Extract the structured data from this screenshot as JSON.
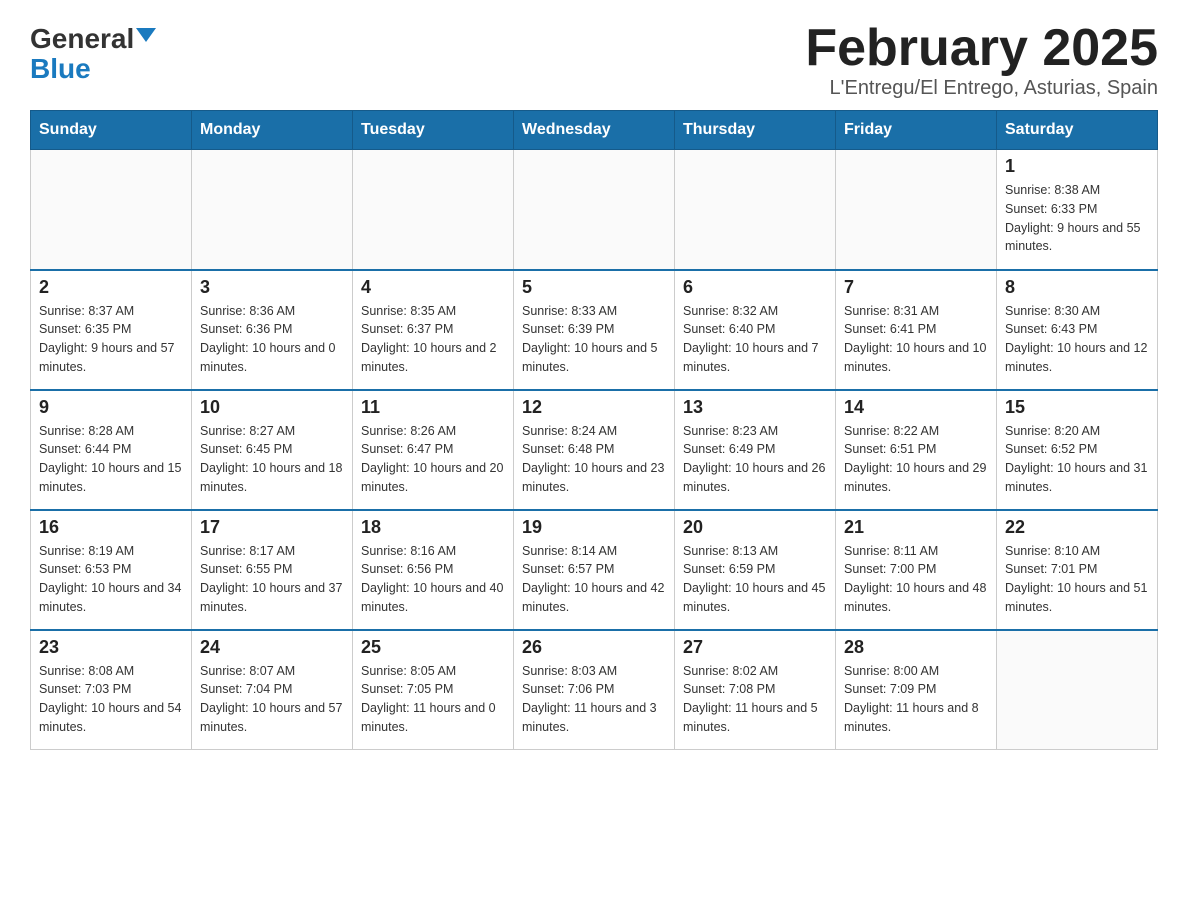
{
  "header": {
    "logo_general": "General",
    "logo_blue": "Blue",
    "title": "February 2025",
    "subtitle": "L'Entregu/El Entrego, Asturias, Spain"
  },
  "days_of_week": [
    "Sunday",
    "Monday",
    "Tuesday",
    "Wednesday",
    "Thursday",
    "Friday",
    "Saturday"
  ],
  "weeks": [
    [
      {
        "day": "",
        "info": ""
      },
      {
        "day": "",
        "info": ""
      },
      {
        "day": "",
        "info": ""
      },
      {
        "day": "",
        "info": ""
      },
      {
        "day": "",
        "info": ""
      },
      {
        "day": "",
        "info": ""
      },
      {
        "day": "1",
        "info": "Sunrise: 8:38 AM\nSunset: 6:33 PM\nDaylight: 9 hours and 55 minutes."
      }
    ],
    [
      {
        "day": "2",
        "info": "Sunrise: 8:37 AM\nSunset: 6:35 PM\nDaylight: 9 hours and 57 minutes."
      },
      {
        "day": "3",
        "info": "Sunrise: 8:36 AM\nSunset: 6:36 PM\nDaylight: 10 hours and 0 minutes."
      },
      {
        "day": "4",
        "info": "Sunrise: 8:35 AM\nSunset: 6:37 PM\nDaylight: 10 hours and 2 minutes."
      },
      {
        "day": "5",
        "info": "Sunrise: 8:33 AM\nSunset: 6:39 PM\nDaylight: 10 hours and 5 minutes."
      },
      {
        "day": "6",
        "info": "Sunrise: 8:32 AM\nSunset: 6:40 PM\nDaylight: 10 hours and 7 minutes."
      },
      {
        "day": "7",
        "info": "Sunrise: 8:31 AM\nSunset: 6:41 PM\nDaylight: 10 hours and 10 minutes."
      },
      {
        "day": "8",
        "info": "Sunrise: 8:30 AM\nSunset: 6:43 PM\nDaylight: 10 hours and 12 minutes."
      }
    ],
    [
      {
        "day": "9",
        "info": "Sunrise: 8:28 AM\nSunset: 6:44 PM\nDaylight: 10 hours and 15 minutes."
      },
      {
        "day": "10",
        "info": "Sunrise: 8:27 AM\nSunset: 6:45 PM\nDaylight: 10 hours and 18 minutes."
      },
      {
        "day": "11",
        "info": "Sunrise: 8:26 AM\nSunset: 6:47 PM\nDaylight: 10 hours and 20 minutes."
      },
      {
        "day": "12",
        "info": "Sunrise: 8:24 AM\nSunset: 6:48 PM\nDaylight: 10 hours and 23 minutes."
      },
      {
        "day": "13",
        "info": "Sunrise: 8:23 AM\nSunset: 6:49 PM\nDaylight: 10 hours and 26 minutes."
      },
      {
        "day": "14",
        "info": "Sunrise: 8:22 AM\nSunset: 6:51 PM\nDaylight: 10 hours and 29 minutes."
      },
      {
        "day": "15",
        "info": "Sunrise: 8:20 AM\nSunset: 6:52 PM\nDaylight: 10 hours and 31 minutes."
      }
    ],
    [
      {
        "day": "16",
        "info": "Sunrise: 8:19 AM\nSunset: 6:53 PM\nDaylight: 10 hours and 34 minutes."
      },
      {
        "day": "17",
        "info": "Sunrise: 8:17 AM\nSunset: 6:55 PM\nDaylight: 10 hours and 37 minutes."
      },
      {
        "day": "18",
        "info": "Sunrise: 8:16 AM\nSunset: 6:56 PM\nDaylight: 10 hours and 40 minutes."
      },
      {
        "day": "19",
        "info": "Sunrise: 8:14 AM\nSunset: 6:57 PM\nDaylight: 10 hours and 42 minutes."
      },
      {
        "day": "20",
        "info": "Sunrise: 8:13 AM\nSunset: 6:59 PM\nDaylight: 10 hours and 45 minutes."
      },
      {
        "day": "21",
        "info": "Sunrise: 8:11 AM\nSunset: 7:00 PM\nDaylight: 10 hours and 48 minutes."
      },
      {
        "day": "22",
        "info": "Sunrise: 8:10 AM\nSunset: 7:01 PM\nDaylight: 10 hours and 51 minutes."
      }
    ],
    [
      {
        "day": "23",
        "info": "Sunrise: 8:08 AM\nSunset: 7:03 PM\nDaylight: 10 hours and 54 minutes."
      },
      {
        "day": "24",
        "info": "Sunrise: 8:07 AM\nSunset: 7:04 PM\nDaylight: 10 hours and 57 minutes."
      },
      {
        "day": "25",
        "info": "Sunrise: 8:05 AM\nSunset: 7:05 PM\nDaylight: 11 hours and 0 minutes."
      },
      {
        "day": "26",
        "info": "Sunrise: 8:03 AM\nSunset: 7:06 PM\nDaylight: 11 hours and 3 minutes."
      },
      {
        "day": "27",
        "info": "Sunrise: 8:02 AM\nSunset: 7:08 PM\nDaylight: 11 hours and 5 minutes."
      },
      {
        "day": "28",
        "info": "Sunrise: 8:00 AM\nSunset: 7:09 PM\nDaylight: 11 hours and 8 minutes."
      },
      {
        "day": "",
        "info": ""
      }
    ]
  ]
}
